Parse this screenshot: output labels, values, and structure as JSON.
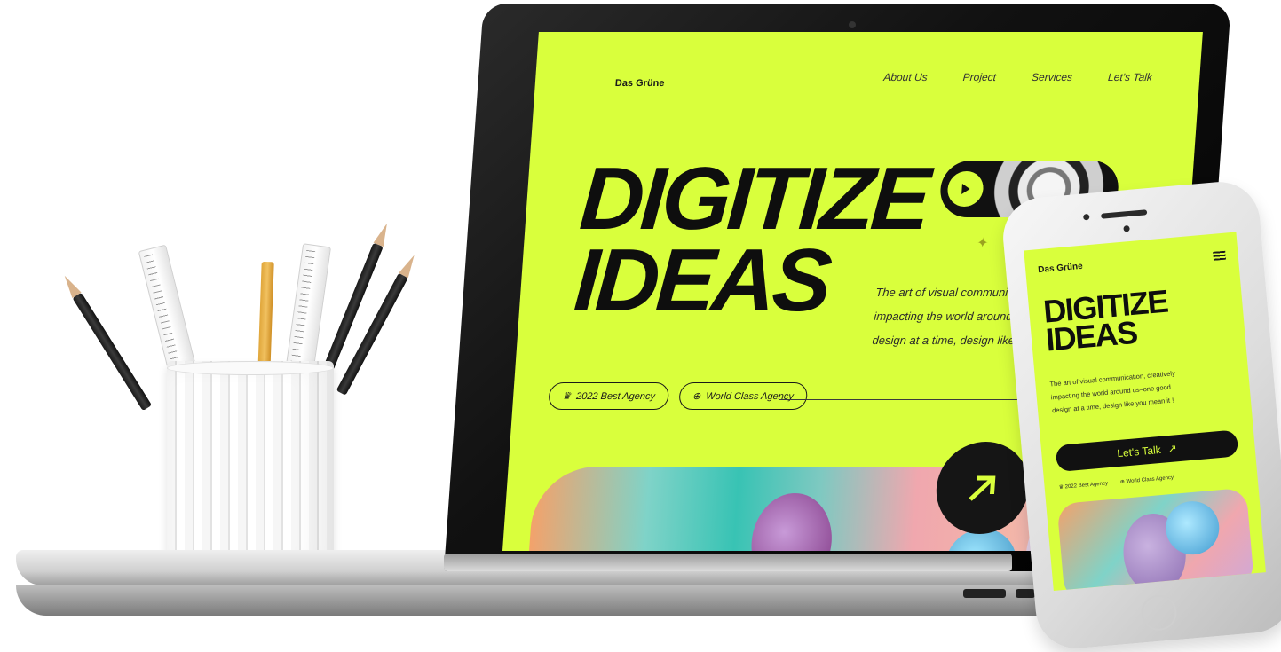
{
  "site": {
    "logo": "Das Grüne",
    "nav": [
      "About Us",
      "Project",
      "Services",
      "Let's Talk"
    ],
    "headline_line1": "DIGITIZE",
    "headline_line2": "IDEAS",
    "description_lines": [
      "The art of visual communication",
      "impacting the world around us—o",
      "design at a time, design like you me"
    ],
    "badges": [
      "2022 Best Agency",
      "World Class Agency"
    ],
    "icons": {
      "play": "play-icon",
      "arrow": "arrow-up-right-icon",
      "badge1": "crown-icon",
      "badge2": "globe-icon",
      "sparkle": "sparkle-icon"
    }
  },
  "phone": {
    "logo": "Das Grüne",
    "headline_line1": "DIGITIZE",
    "headline_line2": "IDEAS",
    "description_lines": [
      "The art of visual communication, creatively",
      "impacting the world around us–one good",
      "design at a time, design like you mean it !"
    ],
    "cta": "Let's Talk",
    "badges": [
      "2022 Best Agency",
      "World Class Agency"
    ],
    "icons": {
      "menu": "hamburger-menu-icon",
      "cta_arrow": "arrow-up-right-icon"
    }
  },
  "colors": {
    "accent": "#d9ff3c",
    "dark": "#111111"
  }
}
